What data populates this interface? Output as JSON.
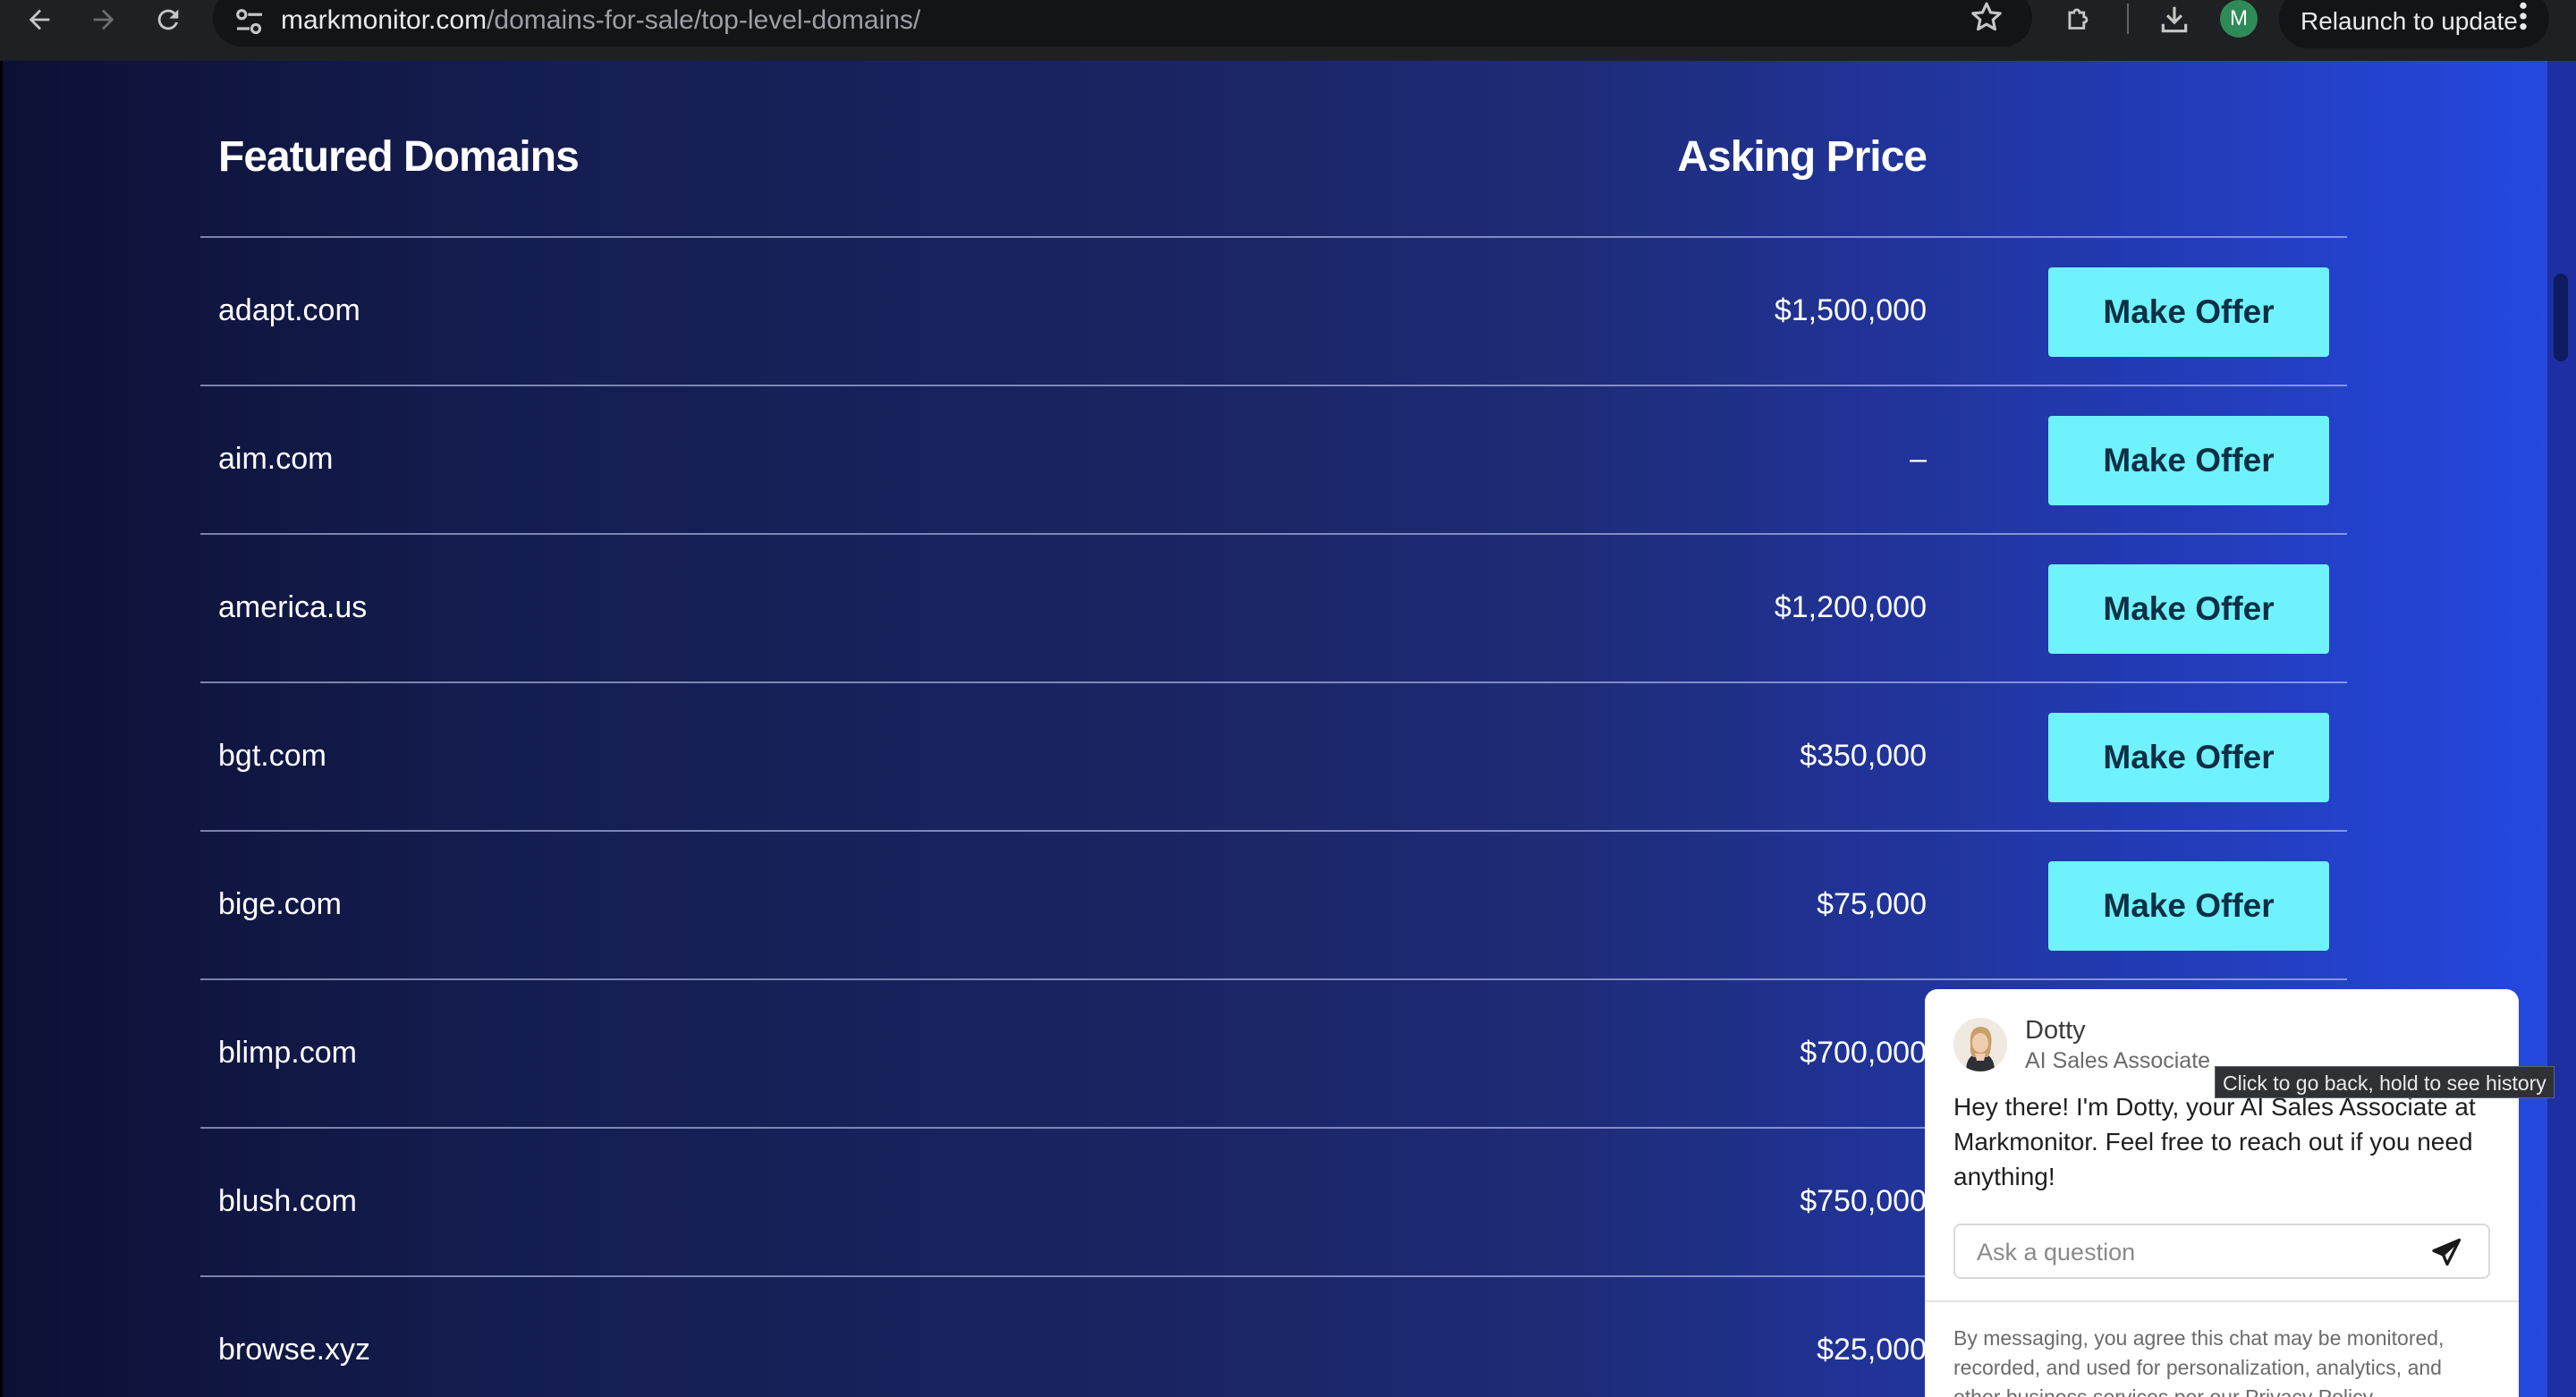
{
  "browser": {
    "url_host": "markmonitor.com",
    "url_path": "/domains-for-sale/top-level-domains/",
    "profile_initial": "M",
    "relaunch_label": "Relaunch to update",
    "tooltip": "Click to go back, hold to see history"
  },
  "table": {
    "header_domain": "Featured Domains",
    "header_price": "Asking Price",
    "button_label": "Make Offer",
    "rows": [
      {
        "domain": "adapt.com",
        "price": "$1,500,000"
      },
      {
        "domain": "aim.com",
        "price": "–"
      },
      {
        "domain": "america.us",
        "price": "$1,200,000"
      },
      {
        "domain": "bgt.com",
        "price": "$350,000"
      },
      {
        "domain": "bige.com",
        "price": "$75,000"
      },
      {
        "domain": "blimp.com",
        "price": "$700,000"
      },
      {
        "domain": "blush.com",
        "price": "$750,000"
      },
      {
        "domain": "browse.xyz",
        "price": "$25,000"
      }
    ]
  },
  "chat": {
    "name": "Dotty",
    "role": "AI Sales Associate",
    "message": "Hey there! I'm Dotty, your AI Sales Associate at Markmonitor. Feel free to reach out if you need anything!",
    "input_placeholder": "Ask a question",
    "disclaimer": "By messaging, you agree this chat may be monitored, recorded, and used for personalization, analytics, and other business services per our Privacy Policy."
  },
  "colors": {
    "button_bg": "#6ff2fb",
    "button_text": "#0d2f45",
    "page_gradient_start": "#0b1034",
    "page_gradient_end": "#2448e0"
  }
}
